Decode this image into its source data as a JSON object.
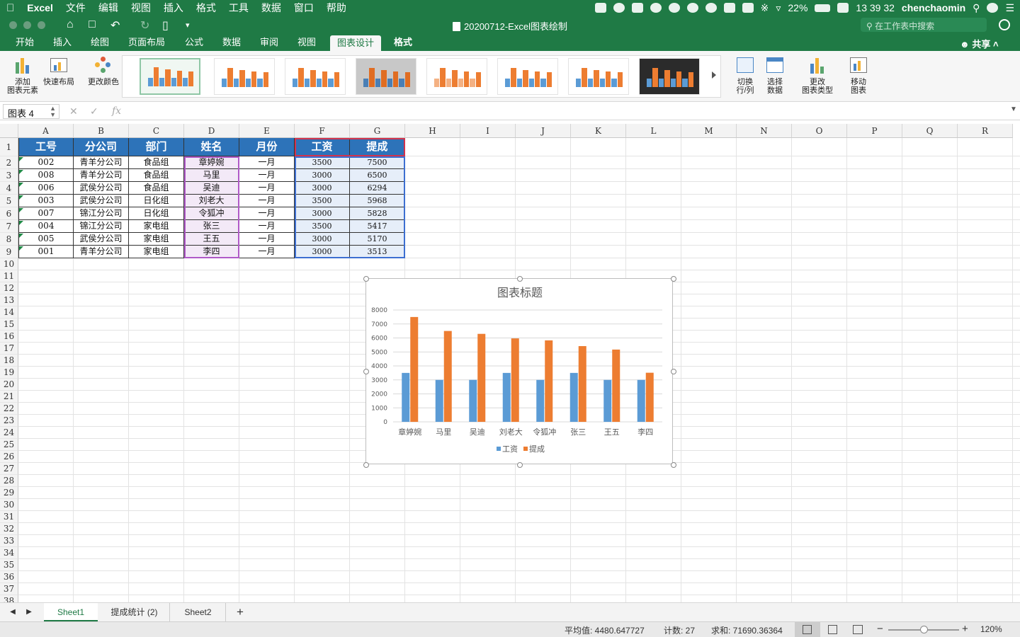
{
  "menubar": {
    "app": "Excel",
    "items": [
      "文件",
      "编辑",
      "视图",
      "插入",
      "格式",
      "工具",
      "数据",
      "窗口",
      "帮助"
    ],
    "battery": "22%",
    "time": "13 39 32",
    "user": "chenchaomin"
  },
  "window": {
    "title": "20200712-Excel图表绘制",
    "search_placeholder": "在工作表中搜索"
  },
  "ribbon": {
    "tabs": [
      "开始",
      "插入",
      "绘图",
      "页面布局",
      "公式",
      "数据",
      "审阅",
      "视图",
      "图表设计",
      "格式"
    ],
    "active_tab": "图表设计",
    "share": "共享",
    "buttons": {
      "add_element_1": "添加",
      "add_element_2": "图表元素",
      "quick_layout": "快速布局",
      "change_colors": "更改颜色",
      "switch_1": "切换",
      "switch_2": "行/列",
      "select_data_1": "选择",
      "select_data_2": "数据",
      "change_type_1": "更改",
      "change_type_2": "图表类型",
      "move_1": "移动",
      "move_2": "图表"
    }
  },
  "formula_bar": {
    "name_box": "图表 4",
    "fx": "fx"
  },
  "columns": [
    "A",
    "B",
    "C",
    "D",
    "E",
    "F",
    "G",
    "H",
    "I",
    "J",
    "K",
    "L",
    "M",
    "N",
    "O",
    "P",
    "Q",
    "R"
  ],
  "row_numbers": [
    "1",
    "2",
    "3",
    "4",
    "5",
    "6",
    "7",
    "8",
    "9",
    "10",
    "11",
    "12",
    "13",
    "14",
    "15",
    "16",
    "17",
    "18",
    "19",
    "20",
    "21",
    "22",
    "23",
    "24",
    "25",
    "26",
    "27",
    "28",
    "29",
    "30",
    "31",
    "32",
    "33",
    "34",
    "35",
    "36",
    "37",
    "38"
  ],
  "table": {
    "headers": [
      "工号",
      "分公司",
      "部门",
      "姓名",
      "月份",
      "工资",
      "提成"
    ],
    "rows": [
      [
        "002",
        "青羊分公司",
        "食品组",
        "章婷婉",
        "一月",
        "3500",
        "7500"
      ],
      [
        "008",
        "青羊分公司",
        "食品组",
        "马里",
        "一月",
        "3000",
        "6500"
      ],
      [
        "006",
        "武侯分公司",
        "食品组",
        "吴迪",
        "一月",
        "3000",
        "6294"
      ],
      [
        "003",
        "武侯分公司",
        "日化组",
        "刘老大",
        "一月",
        "3500",
        "5968"
      ],
      [
        "007",
        "锦江分公司",
        "日化组",
        "令狐冲",
        "一月",
        "3000",
        "5828"
      ],
      [
        "004",
        "锦江分公司",
        "家电组",
        "张三",
        "一月",
        "3500",
        "5417"
      ],
      [
        "005",
        "武侯分公司",
        "家电组",
        "王五",
        "一月",
        "3000",
        "5170"
      ],
      [
        "001",
        "青羊分公司",
        "家电组",
        "李四",
        "一月",
        "3000",
        "3513"
      ]
    ]
  },
  "chart_data": {
    "type": "bar",
    "title": "图表标题",
    "categories": [
      "章婷婉",
      "马里",
      "吴迪",
      "刘老大",
      "令狐冲",
      "张三",
      "王五",
      "李四"
    ],
    "series": [
      {
        "name": "工资",
        "values": [
          3500,
          3000,
          3000,
          3500,
          3000,
          3500,
          3000,
          3000
        ],
        "color": "#5b9bd5"
      },
      {
        "name": "提成",
        "values": [
          7500,
          6500,
          6294,
          5968,
          5828,
          5417,
          5170,
          3513
        ],
        "color": "#ed7d31"
      }
    ],
    "y_ticks": [
      "0",
      "1000",
      "2000",
      "3000",
      "4000",
      "5000",
      "6000",
      "7000",
      "8000"
    ],
    "ylim": [
      0,
      8000
    ],
    "grid": true,
    "legend": "bottom"
  },
  "sheets": [
    "Sheet1",
    "提成统计 (2)",
    "Sheet2"
  ],
  "active_sheet": "Sheet1",
  "status": {
    "average": "平均值: 4480.647727",
    "count": "计数: 27",
    "sum": "求和: 71690.36364",
    "zoom": "120%"
  },
  "colors": {
    "excel_green": "#1f7a45",
    "header_blue": "#2d73b9"
  }
}
